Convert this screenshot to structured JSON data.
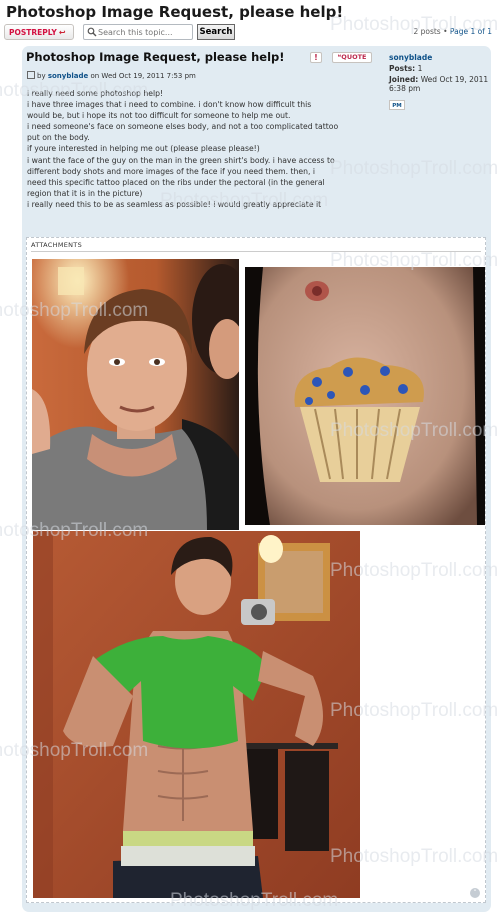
{
  "page": {
    "title": "Photoshop Image Request, please help!"
  },
  "toolbar": {
    "post_reply_label": "POSTREPLY",
    "search_placeholder": "Search this topic...",
    "search_button_label": "Search",
    "pagination_text": "2 posts • ",
    "page_link": "Page 1 of 1"
  },
  "post": {
    "subject": "Photoshop Image Request, please help!",
    "report_label": "!",
    "quote_label": "QUOTE",
    "author_prefix": "by",
    "author": "sonyblade",
    "date": "on Wed Oct 19, 2011 7:53 pm",
    "body_lines": [
      "i really need some photoshop help!",
      "i have three images that i need to combine. i don't know how difficult this",
      "would be, but i hope its not too difficult for someone to help me out.",
      "i need someone's face on someone elses body, and not a too complicated tattoo",
      "put on the body.",
      "if youre interested in helping me out (please please please!)",
      "i want the face of the guy on the man in the green shirt's body. i have access to",
      "different body shots and more images of the face if you need them. then, i",
      "need this specific tattoo placed on the ribs under the pectoral (in the general",
      "region that it is in the picture)",
      "i really need this to be as seamless as possible! i would greatly appreciate it"
    ],
    "attachments_label": "ATTACHMENTS"
  },
  "profile": {
    "username": "sonyblade",
    "posts_label": "Posts:",
    "posts_value": "1",
    "joined_label": "Joined:",
    "joined_value": "Wed Oct 19, 2011 6:38 pm",
    "pm_label": "PM"
  },
  "watermark": "PhotoshopTroll.com",
  "colors": {
    "post_bg": "#e1ebf2",
    "link": "#105289",
    "button_text": "#d31141"
  }
}
